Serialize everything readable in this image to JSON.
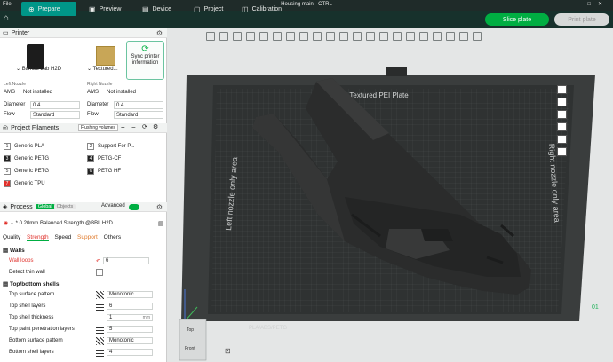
{
  "titlebar": {
    "file": "File",
    "title": "Housing main - CTRL"
  },
  "tabs": [
    {
      "label": "Prepare"
    },
    {
      "label": "Preview"
    },
    {
      "label": "Device"
    },
    {
      "label": "Project"
    },
    {
      "label": "Calibration"
    }
  ],
  "actions": {
    "slice": "Slice plate",
    "print": "Print plate"
  },
  "printer": {
    "section": "Printer",
    "name": "Bambu Lab H2D",
    "plate": "Textured...",
    "sync": "Sync printer information"
  },
  "nozzles": {
    "left": "Left Nozzle",
    "right": "Right Nozzle",
    "ams_label": "AMS",
    "ams_value": "Not installed",
    "diameter_label": "Diameter",
    "diameter_left": "0.4",
    "diameter_right": "0.4",
    "flow_label": "Flow",
    "flow_left": "Standard",
    "flow_right": "Standard"
  },
  "filaments": {
    "section": "Project Filaments",
    "flushing": "Flushing volumes",
    "items": [
      {
        "num": "1",
        "name": "Generic PLA",
        "color": "#f4f4f4"
      },
      {
        "num": "2",
        "name": "Support For P...",
        "color": "#f4f4f4"
      },
      {
        "num": "3",
        "name": "Generic PETG",
        "color": "#222222"
      },
      {
        "num": "4",
        "name": "PETG-CF",
        "color": "#222222"
      },
      {
        "num": "5",
        "name": "Generic PETG",
        "color": "#f4f4f4"
      },
      {
        "num": "6",
        "name": "PETG HF",
        "color": "#222222"
      },
      {
        "num": "7",
        "name": "Generic TPU",
        "color": "#e0312b"
      }
    ]
  },
  "process": {
    "section": "Process",
    "global": "Global",
    "objects": "Objects",
    "advanced": "Advanced",
    "profile": "* 0.20mm Balanced Strength @BBL H2D",
    "tabs": [
      "Quality",
      "Strength",
      "Speed",
      "Support",
      "Others"
    ],
    "walls": "Walls",
    "wall_loops": "Wall loops",
    "wall_loops_value": "6",
    "detect_thin": "Detect thin wall",
    "topbottom": "Top/bottom shells",
    "rows": [
      {
        "label": "Top surface pattern",
        "value": "Monotonic ..."
      },
      {
        "label": "Top shell layers",
        "value": "6"
      },
      {
        "label": "Top shell thickness",
        "value": "1",
        "unit": "mm"
      },
      {
        "label": "Top paint penetration layers",
        "value": "5"
      },
      {
        "label": "Bottom surface pattern",
        "value": "Monotonic"
      },
      {
        "label": "Bottom shell layers",
        "value": "4"
      }
    ]
  },
  "plate": {
    "title": "Bambu Textured PEI Plate",
    "left_text": "Left nozzle only area",
    "right_text": "Right nozzle only area",
    "bottom_text": "PLA/ABS/PETG",
    "number": "01"
  },
  "view": {
    "top": "Top",
    "front": "Front"
  }
}
